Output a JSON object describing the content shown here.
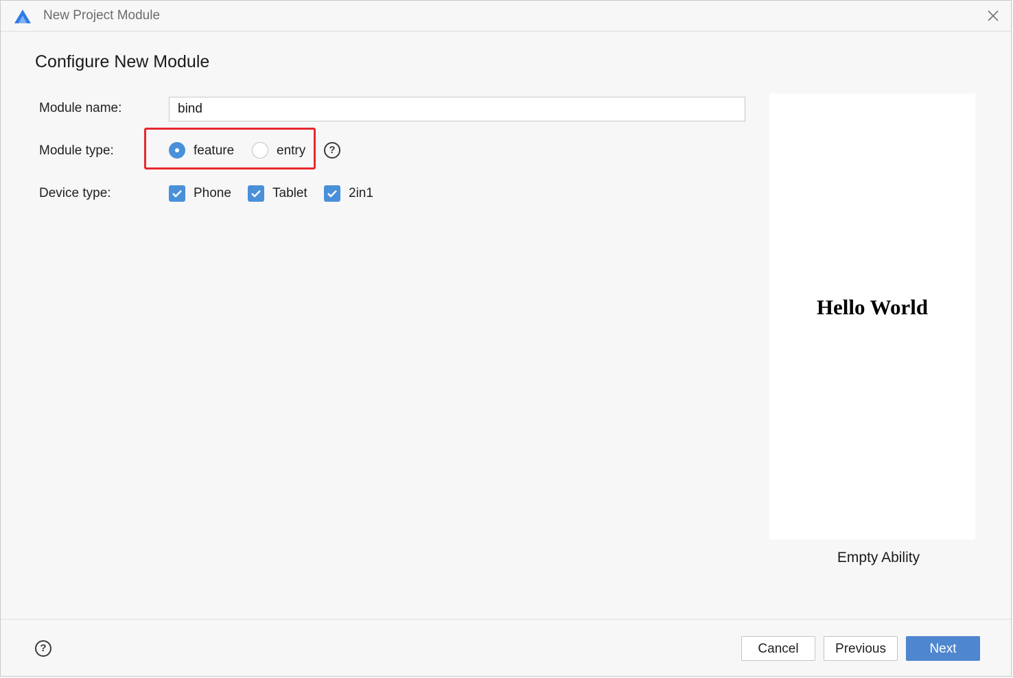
{
  "window": {
    "title": "New Project Module",
    "close_icon": "close-icon",
    "logo_icon": "app-logo-icon"
  },
  "page": {
    "heading": "Configure New Module"
  },
  "form": {
    "module_name": {
      "label": "Module name:",
      "value": "bind"
    },
    "module_type": {
      "label": "Module type:",
      "options": [
        {
          "label": "feature",
          "selected": true
        },
        {
          "label": "entry",
          "selected": false
        }
      ],
      "help_icon": "question-icon",
      "help_glyph": "?"
    },
    "device_type": {
      "label": "Device type:",
      "options": [
        {
          "label": "Phone",
          "checked": true
        },
        {
          "label": "Tablet",
          "checked": true
        },
        {
          "label": "2in1",
          "checked": true
        }
      ]
    }
  },
  "preview": {
    "screen_text": "Hello World",
    "caption": "Empty Ability"
  },
  "footer": {
    "help_icon": "question-icon",
    "help_glyph": "?",
    "cancel_label": "Cancel",
    "previous_label": "Previous",
    "next_label": "Next"
  },
  "colors": {
    "accent": "#4a90d9",
    "primary_button": "#4e86cf",
    "highlight_border": "#e8282d"
  }
}
